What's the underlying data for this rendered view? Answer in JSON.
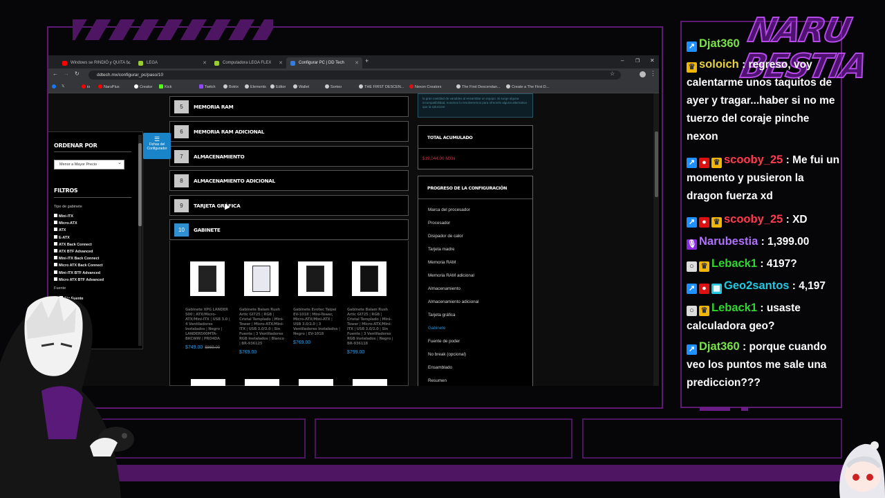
{
  "browser": {
    "tabs": [
      {
        "label": "Windows se RINDIÓ y QUITA f...",
        "color": "#ff0000"
      },
      {
        "label": "LEGA",
        "color": "#9acd32"
      },
      {
        "label": "Computadora LEGA FLEX",
        "color": "#9acd32"
      },
      {
        "label": "Configurar PC | DD Tech",
        "color": "#3a7bd5"
      }
    ],
    "url": "ddtech.mx/configurar_pc/paso/10",
    "bookmarks": [
      "NaruPlus",
      "Creator",
      "Kick",
      "Twitch",
      "Botrix",
      "Elements",
      "Editor",
      "Wallet",
      "Sorteo",
      "THE FIRST DESCEN...",
      "Nexon Creators",
      "The First Descendan...",
      "Create a The First D..."
    ]
  },
  "sidebar": {
    "order_title": "ORDENAR POR",
    "order_value": "Menor a Mayor Precio",
    "filters_title": "FILTROS",
    "type_label": "Tipo de gabinete",
    "types": [
      "Mini-ITX",
      "Micro-ATX",
      "ATX",
      "E-ATX",
      "ATX Back Connect",
      "ATX BTF Advanced",
      "Mini-ITX Back Connect",
      "Micro ATX Back Connect",
      "Mini-ITX BTF Advanced",
      "Micro ATX BTF Advanced"
    ],
    "psu_label": "Fuente",
    "psu_option": "Sin Fuente",
    "partial_label": "uake",
    "ficha_label": "Fichas del Configurador"
  },
  "steps": [
    {
      "num": "5",
      "label": "MEMORIA RAM"
    },
    {
      "num": "6",
      "label": "MEMORIA RAM ADICIONAL"
    },
    {
      "num": "7",
      "label": "ALMACENAMIENTO"
    },
    {
      "num": "8",
      "label": "ALMACENAMIENTO ADICIONAL"
    },
    {
      "num": "9",
      "label": "TARJETA GRÁFICA"
    },
    {
      "num": "10",
      "label": "GABINETE"
    }
  ],
  "products": [
    {
      "name": "Gabinete XPG LANDER 500 | ATX/Micro-ATX/Mini-ITX | USB 3.0 | 4 Ventiladores Instalados | Negro | LANDER500MTA-BKCWW | PRO4DA",
      "price": "$749.00",
      "old_price": "$869.00",
      "color": "#222"
    },
    {
      "name": "Gabinete Balam Rush Artic GI725 | RGB | Cristal Templado | Mini-Tower | Micro-ATX/Mini-ITX | USB 3.0/2.0 | Sin Fuente | 3 Ventiladores RGB Instalados | Blanco | BR-936125",
      "price": "$769.00",
      "old_price": "",
      "color": "#e8e8f0"
    },
    {
      "name": "Gabinete Evotec Taipei EV-1018 | Mini-Tower, Micro-ATX/Mini-ATX | USB 3.0/2.0 | 3 Ventiladores Instalados | Negro | EV-1018",
      "price": "$769.00",
      "old_price": "",
      "color": "#1a1a1a"
    },
    {
      "name": "Gabinete Balam Rush Artic GI725 | RGB | Cristal Templado | Mini-Tower | Micro-ATX/Mini-ITX | USB 3.0/2.0 | Sin Fuente | 3 Ventiladores RGB Instalados | Negro | BR-936118",
      "price": "$799.00",
      "old_price": "",
      "color": "#111"
    }
  ],
  "notice": "la gran cantidad de variables al ensamblar un equipo. Si surge alguna incompatibilidad, nosotros lo resolveremos para ofrecerle alguna alternativa que la solucione",
  "total": {
    "title": "TOTAL ACUMULADO",
    "value": "$19,044.00 MXN"
  },
  "progress": {
    "title": "PROGRESO DE LA CONFIGURACIÓN",
    "items": [
      "Marca del procesador",
      "Procesador",
      "Disipador de calor",
      "Tarjeta madre",
      "Memoria RAM",
      "Memoria RAM adicional",
      "Almacenamiento",
      "Almacenamiento adicional",
      "Tarjeta gráfica",
      "Gabinete",
      "Fuente de poder",
      "No break (opcional)",
      "Ensamblado",
      "Resumen"
    ],
    "current": "Gabinete"
  },
  "logo": "NARU BESTIA",
  "chat": [
    {
      "user": "Djat360",
      "text": "",
      "color": "#7be34a",
      "badges": [
        "#1e90ff"
      ]
    },
    {
      "user": "soloich",
      "text": ": regreso, voy calentarme unos taquitos de ayer y tragar...haber si no me tuerzo del coraje pinche nexon",
      "color": "#e8d23a",
      "badges": [
        "#f2b705"
      ]
    },
    {
      "user": "scooby_25",
      "text": ": Me fui un momento y pusieron la dragon fuerza xd",
      "color": "#ff3b4e",
      "badges": [
        "#1e90ff",
        "#d11",
        "#f2b705"
      ]
    },
    {
      "user": "scooby_25",
      "text": ": XD",
      "color": "#ff3b4e",
      "badges": [
        "#1e90ff",
        "#d11",
        "#f2b705"
      ]
    },
    {
      "user": "Narubestia",
      "text": ": 1,399.00",
      "color": "#b070ff",
      "badges": [
        "#8a2be2"
      ]
    },
    {
      "user": "Leback1",
      "text": ": 4197?",
      "color": "#2fd82f",
      "badges": [
        "#ddd",
        "#f2b705"
      ]
    },
    {
      "user": "Geo2santos",
      "text": ": 4,197",
      "color": "#22c7e0",
      "badges": [
        "#1e90ff",
        "#d11",
        "#22c7e0"
      ]
    },
    {
      "user": "Leback1",
      "text": ": usaste calculadora geo?",
      "color": "#2fd82f",
      "badges": [
        "#ddd",
        "#f2b705"
      ]
    },
    {
      "user": "Djat360",
      "text": ": porque cuando veo los puntos me sale una prediccion???",
      "color": "#7be34a",
      "badges": [
        "#1e90ff"
      ]
    }
  ]
}
